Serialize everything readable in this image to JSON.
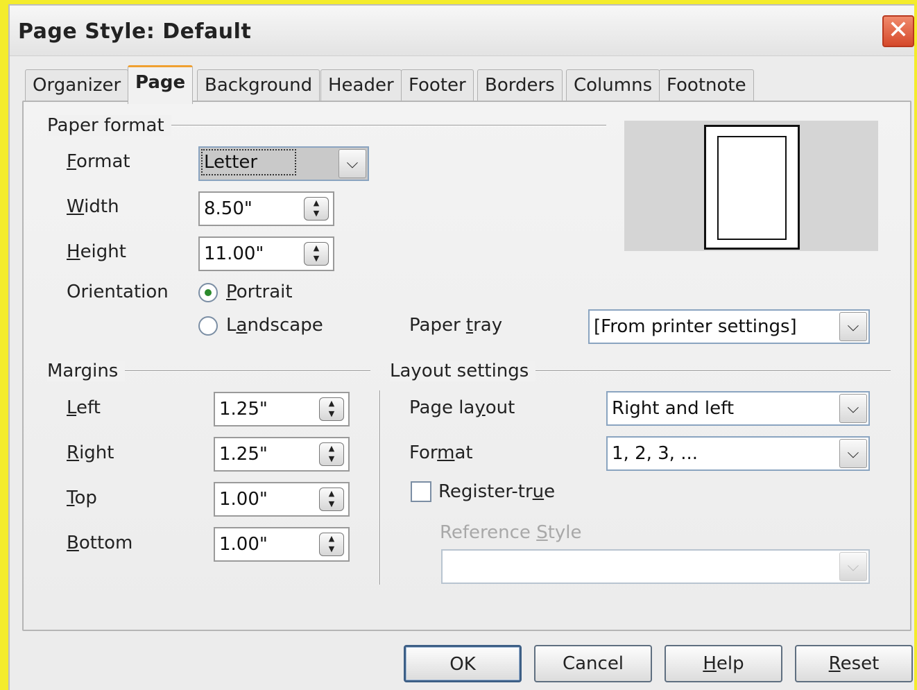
{
  "window": {
    "title": "Page Style: Default",
    "close_glyph": "✕"
  },
  "tabs": [
    "Organizer",
    "Page",
    "Background",
    "Header",
    "Footer",
    "Borders",
    "Columns",
    "Footnote"
  ],
  "active_tab": "Page",
  "paper_format": {
    "group_label": "Paper format",
    "format_label_pre": "",
    "format_label_u": "F",
    "format_label_post": "ormat",
    "format_value": "Letter",
    "width_label_pre": "",
    "width_label_u": "W",
    "width_label_post": "idth",
    "width_value": "8.50\"",
    "height_label_pre": "",
    "height_label_u": "H",
    "height_label_post": "eight",
    "height_value": "11.00\"",
    "orientation_label": "Orientation",
    "portrait_pre": "",
    "portrait_u": "P",
    "portrait_post": "ortrait",
    "landscape_pre": "L",
    "landscape_u": "a",
    "landscape_post": "ndscape",
    "orientation_selected": "Portrait",
    "paper_tray_pre": "Paper ",
    "paper_tray_u": "t",
    "paper_tray_post": "ray",
    "paper_tray_value": "[From printer settings]"
  },
  "margins": {
    "group_label": "Margins",
    "left_pre": "",
    "left_u": "L",
    "left_post": "eft",
    "left_value": "1.25\"",
    "right_pre": "",
    "right_u": "R",
    "right_post": "ight",
    "right_value": "1.25\"",
    "top_pre": "",
    "top_u": "T",
    "top_post": "op",
    "top_value": "1.00\"",
    "bottom_pre": "",
    "bottom_u": "B",
    "bottom_post": "ottom",
    "bottom_value": "1.00\""
  },
  "layout_settings": {
    "group_label": "Layout settings",
    "page_layout_pre": "Page la",
    "page_layout_u": "y",
    "page_layout_post": "out",
    "page_layout_value": "Right and left",
    "format_pre": "For",
    "format_u": "m",
    "format_post": "at",
    "format_value": "1, 2, 3, ...",
    "register_true_pre": "Register-tr",
    "register_true_u": "u",
    "register_true_post": "e",
    "register_true_checked": false,
    "reference_style_pre": "Reference ",
    "reference_style_u": "S",
    "reference_style_post": "tyle",
    "reference_style_value": ""
  },
  "buttons": {
    "ok": "OK",
    "cancel": "Cancel",
    "help_pre": "",
    "help_u": "H",
    "help_post": "elp",
    "reset_pre": "",
    "reset_u": "R",
    "reset_post": "eset"
  },
  "icons": {
    "dropdown": "chevron-down-icon",
    "spin": "spin-updown-icon",
    "close": "close-icon"
  },
  "colors": {
    "background": "#f4ec2c",
    "tab_highlight": "#f0a030",
    "close_button": "#d5492b"
  }
}
